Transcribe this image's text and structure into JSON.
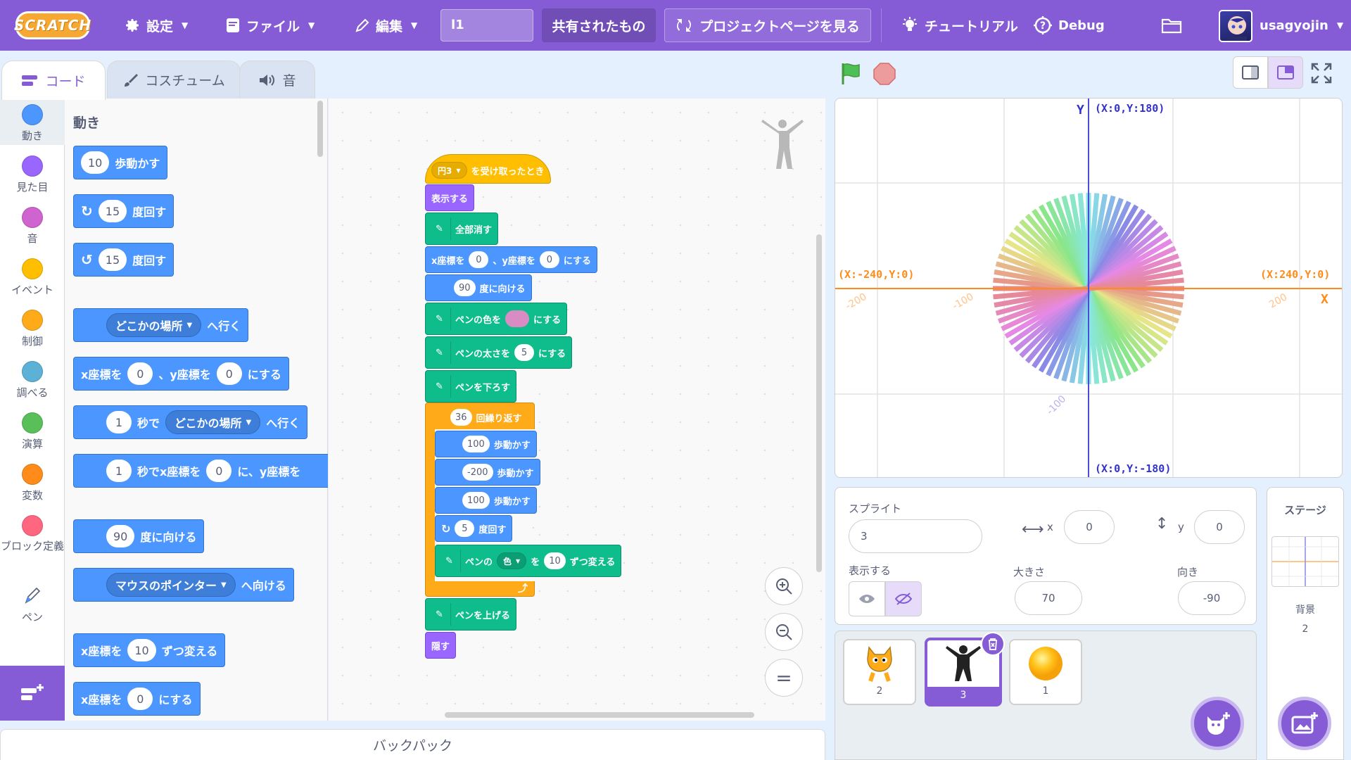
{
  "menubar": {
    "logo_text": "SCRATCH",
    "settings": "設定",
    "file": "ファイル",
    "edit": "編集",
    "project_title": "l1",
    "shared": "共有されたもの",
    "project_page": "プロジェクトページを見る",
    "tutorial": "チュートリアル",
    "debug": "Debug",
    "username": "usagyojin"
  },
  "tabs": {
    "code": "コード",
    "costume": "コスチューム",
    "sound": "音"
  },
  "categories": [
    {
      "label": "動き",
      "color": "#4c97ff"
    },
    {
      "label": "見た目",
      "color": "#9966ff"
    },
    {
      "label": "音",
      "color": "#cf63cf"
    },
    {
      "label": "イベント",
      "color": "#ffbf00"
    },
    {
      "label": "制御",
      "color": "#ffab19"
    },
    {
      "label": "調べる",
      "color": "#5cb1d6"
    },
    {
      "label": "演算",
      "color": "#59c059"
    },
    {
      "label": "変数",
      "color": "#ff8c1a"
    },
    {
      "label": "ブロック定義",
      "color": "#ff6680"
    },
    {
      "label": "ペン",
      "color": "#0fbd8c"
    }
  ],
  "palette": {
    "title": "動き",
    "move_val": "10",
    "move_txt": "歩動かす",
    "turn_r_val": "15",
    "turn_txt": "度回す",
    "turn_l_val": "15",
    "goto_dd": "どこかの場所",
    "goto_txt": "へ行く",
    "gotoxy_a": "x座標を",
    "gotoxy_x": "0",
    "gotoxy_b": "、y座標を",
    "gotoxy_y": "0",
    "gotoxy_c": "にする",
    "glide_val": "1",
    "glide_a": "秒で",
    "glide_dd": "どこかの場所",
    "glide_b": "へ行く",
    "glidexy_val": "1",
    "glidexy_a": "秒でx座標を",
    "glidexy_x": "0",
    "glidexy_b": "に、y座標を",
    "point_val": "90",
    "point_txt": "度に向ける",
    "towards_dd": "マウスのポインター",
    "towards_txt": "へ向ける",
    "changex_a": "x座標を",
    "changex_val": "10",
    "changex_b": "ずつ変える",
    "setx_a": "x座標を",
    "setx_val": "0",
    "setx_b": "にする"
  },
  "script": {
    "hat_dd": "円3",
    "hat_txt": "を受け取ったとき",
    "show": "表示する",
    "clear": "全部消す",
    "goto_a": "x座標を",
    "goto_x": "0",
    "goto_b": "、y座標を",
    "goto_y": "0",
    "goto_c": "にする",
    "point_val": "90",
    "point_txt": "度に向ける",
    "setcolor_a": "ペンの色を",
    "setcolor_b": "にする",
    "pen_color": "#d98cc3",
    "setsize_a": "ペンの太さを",
    "setsize_val": "5",
    "setsize_b": "にする",
    "pendown": "ペンを下ろす",
    "repeat_val": "36",
    "repeat_txt": "回繰り返す",
    "m1_val": "100",
    "m2_val": "-200",
    "m3_val": "100",
    "move_txt": "歩動かす",
    "turn_val": "5",
    "turn_txt": "度回す",
    "change_a": "ペンの",
    "change_dd": "色",
    "change_b": "を",
    "change_val": "10",
    "change_c": "ずつ変える",
    "penup": "ペンを上げる",
    "hide": "隠す"
  },
  "backpack": "バックパック",
  "stage": {
    "y_label": "Y",
    "x_label": "X",
    "top": "(X:0,Y:180)",
    "bottom": "(X:0,Y:-180)",
    "left": "(X:-240,Y:0)",
    "right": "(X:240,Y:0)",
    "t1": "-200",
    "t2": "-100",
    "t3": "200",
    "t4": "-100"
  },
  "sprite_info": {
    "sprite_label": "スプライト",
    "sprite_name": "3",
    "x_label": "x",
    "x": "0",
    "y_label": "y",
    "y": "0",
    "show_label": "表示する",
    "size_label": "大きさ",
    "size": "70",
    "dir_label": "向き",
    "dir": "-90"
  },
  "sprites": [
    {
      "name": "2"
    },
    {
      "name": "3"
    },
    {
      "name": "1"
    }
  ],
  "stage_pane": {
    "title": "ステージ",
    "bg_label": "背景",
    "bg_count": "2"
  }
}
